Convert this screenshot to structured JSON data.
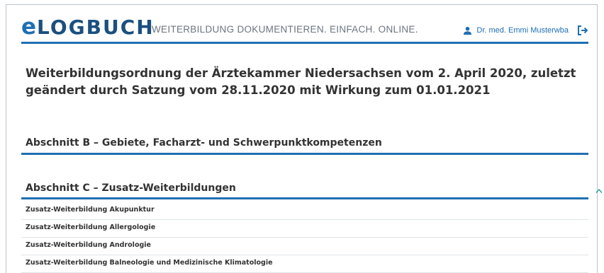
{
  "header": {
    "logo_initial": "e",
    "logo_rest": "LOGBUCH",
    "tagline": "WEITERBILDUNG DOKUMENTIEREN. EINFACH. ONLINE.",
    "user_name": "Dr. med. Emmi Musterwba"
  },
  "main": {
    "title": "Weiterbildungsordnung der Ärztekammer Niedersachsen vom 2. April 2020, zuletzt geändert durch Satzung vom 28.11.2020 mit Wirkung zum 01.01.2021",
    "sections": [
      {
        "label": "Abschnitt B – Gebiete, Facharzt- und Schwerpunktkompetenzen"
      },
      {
        "label": "Abschnitt C – Zusatz-Weiterbildungen"
      }
    ],
    "items": [
      {
        "label": "Zusatz-Weiterbildung Akupunktur"
      },
      {
        "label": "Zusatz-Weiterbildung Allergologie"
      },
      {
        "label": "Zusatz-Weiterbildung Andrologie"
      },
      {
        "label": "Zusatz-Weiterbildung Balneologie und Medizinische Klimatologie"
      }
    ]
  },
  "colors": {
    "accent": "#1f6fb2",
    "text": "#333333"
  }
}
